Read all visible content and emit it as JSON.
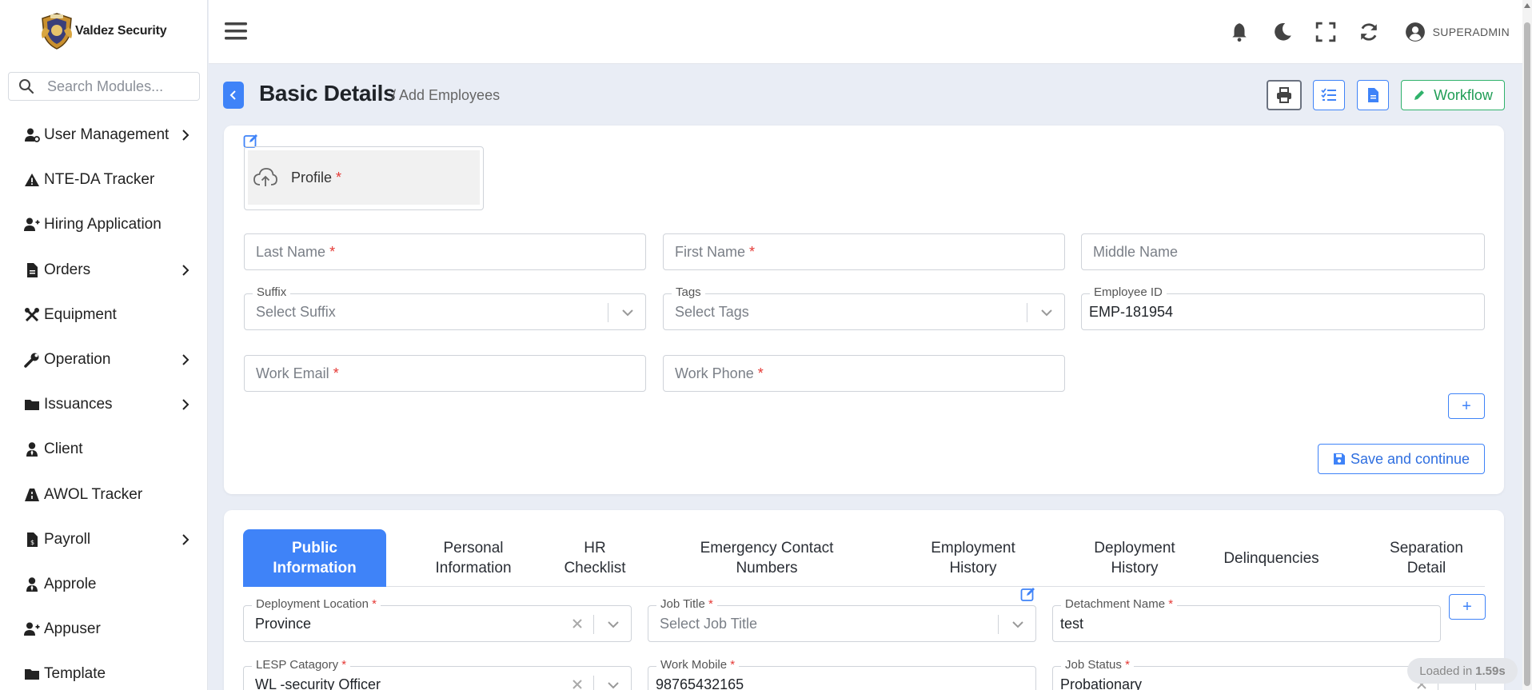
{
  "brand": {
    "name": "Valdez Security"
  },
  "search": {
    "placeholder": "Search Modules..."
  },
  "sidebar": {
    "items": [
      {
        "label": "User Management",
        "icon": "user-gear-icon",
        "has_children": true
      },
      {
        "label": "NTE-DA Tracker",
        "icon": "warning-icon",
        "has_children": false
      },
      {
        "label": "Hiring Application",
        "icon": "user-plus-icon",
        "has_children": false
      },
      {
        "label": "Orders",
        "icon": "file-icon",
        "has_children": true
      },
      {
        "label": "Equipment",
        "icon": "tools-icon",
        "has_children": false
      },
      {
        "label": "Operation",
        "icon": "wrench-icon",
        "has_children": true
      },
      {
        "label": "Issuances",
        "icon": "folder-icon",
        "has_children": true
      },
      {
        "label": "Client",
        "icon": "user-tie-icon",
        "has_children": false
      },
      {
        "label": "AWOL Tracker",
        "icon": "road-icon",
        "has_children": false
      },
      {
        "label": "Payroll",
        "icon": "invoice-icon",
        "has_children": true
      },
      {
        "label": "Approle",
        "icon": "user-tie-icon",
        "has_children": false
      },
      {
        "label": "Appuser",
        "icon": "user-plus-icon",
        "has_children": false
      },
      {
        "label": "Template",
        "icon": "folder-icon",
        "has_children": false
      }
    ]
  },
  "topbar": {
    "user": "SUPERADMIN"
  },
  "header": {
    "title": "Basic Details",
    "breadcrumb": "/ Add Employees",
    "workflow_label": "Workflow"
  },
  "basic": {
    "profile_label": "Profile",
    "last_name_placeholder": "Last Name",
    "first_name_placeholder": "First Name",
    "middle_name_placeholder": "Middle Name",
    "suffix_label": "Suffix",
    "suffix_placeholder": "Select Suffix",
    "tags_label": "Tags",
    "tags_placeholder": "Select Tags",
    "employee_id_label": "Employee ID",
    "employee_id_value": "EMP-181954",
    "work_email_placeholder": "Work Email",
    "work_phone_placeholder": "Work Phone",
    "plus_label": "+",
    "save_label": "Save and continue",
    "required_mark": "*"
  },
  "tabs": [
    {
      "label": "Public Information",
      "active": true
    },
    {
      "label": "Personal Information",
      "active": false
    },
    {
      "label": "HR Checklist",
      "active": false
    },
    {
      "label": "Emergency Contact Numbers",
      "active": false
    },
    {
      "label": "Employment History",
      "active": false
    },
    {
      "label": "Deployment History",
      "active": false
    },
    {
      "label": "Delinquencies",
      "active": false
    },
    {
      "label": "Separation Detail",
      "active": false
    }
  ],
  "public_info": {
    "deployment_location_label": "Deployment Location",
    "deployment_location_value": "Province",
    "job_title_label": "Job Title",
    "job_title_placeholder": "Select Job Title",
    "detachment_name_label": "Detachment Name",
    "detachment_name_value": "test",
    "lesp_label": "LESP Catagory",
    "lesp_value": "WL -security Officer",
    "work_mobile_label": "Work Mobile",
    "work_mobile_value": "98765432165",
    "job_status_label": "Job Status",
    "job_status_value": "Probationary"
  },
  "status": {
    "loaded_prefix": "Loaded in",
    "loaded_time": "1.59s"
  },
  "colors": {
    "accent": "#3f83f8",
    "success": "#30b26b",
    "required": "#e53935"
  }
}
